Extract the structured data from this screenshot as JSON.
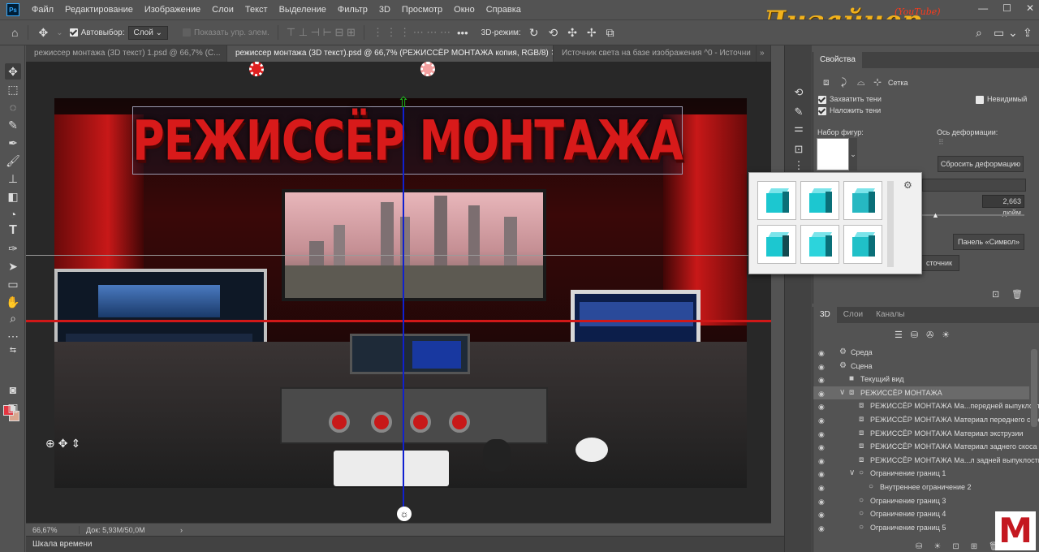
{
  "app": {
    "logo": "Ps"
  },
  "menu": [
    "Файл",
    "Редактирование",
    "Изображение",
    "Слои",
    "Текст",
    "Выделение",
    "Фильтр",
    "3D",
    "Просмотр",
    "Окно",
    "Справка"
  ],
  "window_controls": {
    "minimize": "—",
    "maximize": "☐",
    "close": "✕"
  },
  "watermark": {
    "title": "Дизайнер",
    "subtitle": "(YouTube)"
  },
  "options": {
    "autoselect_label": "Автовыбор:",
    "autoselect_value": "Слой",
    "show_controls_label": "Показать упр. элем.",
    "mode_label": "3D-режим:",
    "more": "•••"
  },
  "tabs": [
    {
      "label": "режиссер монтажа (3D текст) 1.psd @ 66,7% (С..."
    },
    {
      "label": "режиссер монтажа (3D текст).psd @ 66,7% (РЕЖИССЁР МОНТАЖА копия, RGB/8)"
    },
    {
      "label": "Источник света на базе изображения ^0 - Источни"
    }
  ],
  "tab_close": "✕",
  "tab_overflow": "»",
  "canvas": {
    "headline": "РЕЖИССЁР МОНТАЖА"
  },
  "status": {
    "zoom": "66,67%",
    "doc": "Док: 5,93M/50,0M",
    "arrow": "›"
  },
  "timeline": {
    "label": "Шкала времени"
  },
  "properties": {
    "tab": "Свойства",
    "mesh_label": "Сетка",
    "capture_shadows": "Захватить тени",
    "cast_shadows": "Наложить тени",
    "invisible": "Невидимый",
    "shape_preset": "Набор фигур:",
    "deform_axis": "Ось деформации:",
    "reset_deform": "Сбросить деформацию",
    "depth_value": "2,663 дюйм",
    "symbol_panel": "Панель «Символ»",
    "source_btn": "сточник"
  },
  "panel3d": {
    "tabs": [
      "3D",
      "Слои",
      "Каналы"
    ],
    "rows": [
      {
        "label": "Среда",
        "indent": 0,
        "icon": "env"
      },
      {
        "label": "Сцена",
        "indent": 0,
        "icon": "scene"
      },
      {
        "label": "Текущий вид",
        "indent": 1,
        "icon": "camera"
      },
      {
        "label": "РЕЖИССЁР МОНТАЖА",
        "indent": 1,
        "icon": "mesh",
        "selected": true,
        "expand": "∨"
      },
      {
        "label": "РЕЖИССЁР МОНТАЖА Ма...передней выпуклости",
        "indent": 2,
        "icon": "material"
      },
      {
        "label": "РЕЖИССЁР МОНТАЖА Материал переднего скоса",
        "indent": 2,
        "icon": "material"
      },
      {
        "label": "РЕЖИССЁР МОНТАЖА Материал экструзии",
        "indent": 2,
        "icon": "material"
      },
      {
        "label": "РЕЖИССЁР МОНТАЖА Материал заднего скоса",
        "indent": 2,
        "icon": "material"
      },
      {
        "label": "РЕЖИССЁР МОНТАЖА Ма...л задней выпуклости",
        "indent": 2,
        "icon": "material"
      },
      {
        "label": "Ограничение границ 1",
        "indent": 2,
        "icon": "constraint",
        "expand": "∨"
      },
      {
        "label": "Внутреннее ограничение 2",
        "indent": 3,
        "icon": "constraint"
      },
      {
        "label": "Ограничение границ 3",
        "indent": 2,
        "icon": "constraint"
      },
      {
        "label": "Ограничение границ 4",
        "indent": 2,
        "icon": "constraint"
      },
      {
        "label": "Ограничение границ 5",
        "indent": 2,
        "icon": "constraint"
      }
    ]
  },
  "colors": {
    "foreground": "#e33641",
    "background": "#d9a58d",
    "accent_red": "#d01818",
    "axis_blue": "#1020d0",
    "cube": "#1cc7d0"
  }
}
